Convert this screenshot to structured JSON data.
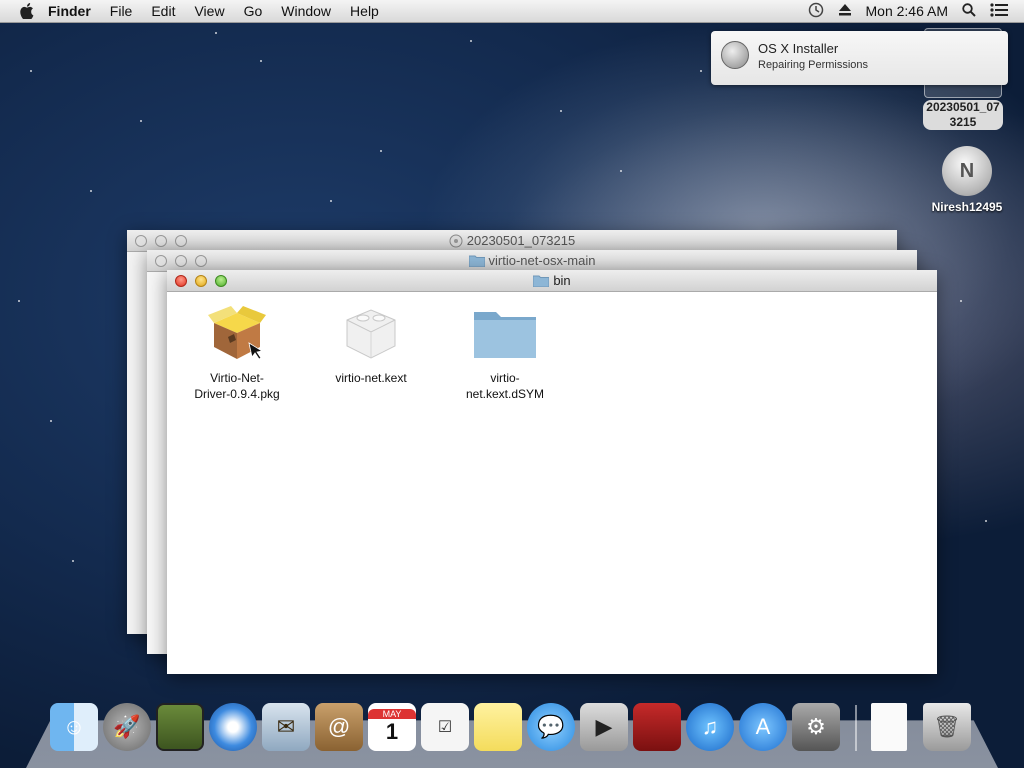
{
  "menubar": {
    "items": [
      "Finder",
      "File",
      "Edit",
      "View",
      "Go",
      "Window",
      "Help"
    ],
    "clock": "Mon 2:46 AM",
    "status_icons": [
      "time-machine-icon",
      "eject-icon",
      "spotlight-icon",
      "notification-center-icon"
    ]
  },
  "notification": {
    "title": "OS X Installer",
    "subtitle": "Repairing Permissions",
    "icon": "installer-icon"
  },
  "desktop": {
    "icons": [
      {
        "label_line1": "20230501_07",
        "label_line2": "3215",
        "icon": "disk-image-icon"
      },
      {
        "label": "Niresh12495",
        "icon": "startup-disk-icon"
      }
    ]
  },
  "windows": [
    {
      "title": "20230501_073215",
      "icon": "disk-image-icon"
    },
    {
      "title": "virtio-net-osx-main",
      "icon": "folder-icon"
    },
    {
      "title": "bin",
      "icon": "folder-icon"
    }
  ],
  "files": [
    {
      "line1": "Virtio-Net-",
      "line2": "Driver-0.9.4.pkg",
      "icon": "package-icon"
    },
    {
      "line1": "virtio-net.kext",
      "line2": "",
      "icon": "kext-lego-icon"
    },
    {
      "line1": "virtio-",
      "line2": "net.kext.dSYM",
      "icon": "folder-icon"
    }
  ],
  "dock": {
    "apps": [
      "finder-icon",
      "launchpad-icon",
      "mission-control-icon",
      "safari-icon",
      "mail-icon",
      "contacts-icon",
      "calendar-icon",
      "reminders-icon",
      "notes-icon",
      "messages-icon",
      "facetime-icon",
      "photo-booth-icon",
      "itunes-icon",
      "app-store-icon",
      "system-preferences-icon",
      "document-icon",
      "trash-icon"
    ],
    "calendar_month": "MAY",
    "calendar_day": "1"
  },
  "colors": {
    "desktop_bg": "#1e3c69",
    "close": "#e0301f",
    "minimize": "#e0a516",
    "zoom": "#4fae2b",
    "folder": "#8db6d6"
  }
}
